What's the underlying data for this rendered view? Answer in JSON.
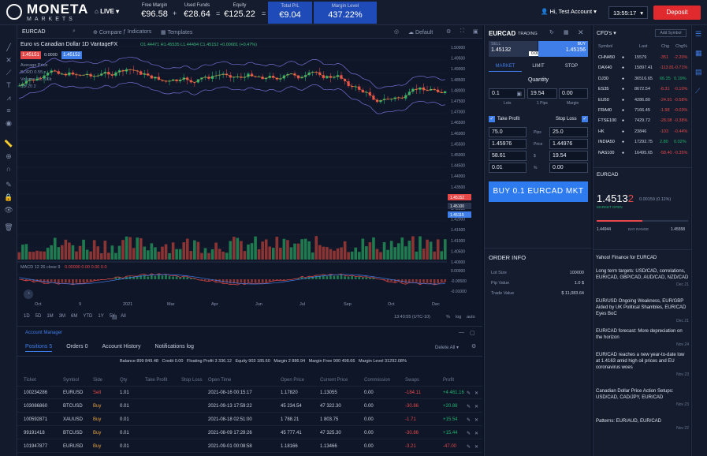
{
  "brand": {
    "name": "MONETA",
    "sub": "MARKETS"
  },
  "account": {
    "mode": "LIVE",
    "free_margin_label": "Free Margin",
    "free_margin": "€96.58",
    "used_funds_label": "Used Funds",
    "used_funds": "€28.64",
    "equity_label": "Equity",
    "equity": "€125.22",
    "total_pl_label": "Total P/L",
    "total_pl": "€9.04",
    "margin_level_label": "Margin Level",
    "margin_level": "437.22%",
    "ops": [
      "+",
      "=",
      "="
    ]
  },
  "user": {
    "greeting": "Hi, Test Account",
    "time": "13:55:17",
    "deposit": "Deposit"
  },
  "chart": {
    "symbol": "EURCAD",
    "compare": "Compare",
    "indicators": "Indicators",
    "templates": "Templates",
    "layout": "Default",
    "legend_title": "Euro vs Canadian Dollar 1D VantageFX",
    "ohlc": "O1.44471 H1.45535 L1.44494 C1.45152 +0.00681 (+0.47%)",
    "sell": "1.45151",
    "spread": "0.0000",
    "buy": "1.45152",
    "ind1": "Average Price",
    "ind2": "BORD 0.55 s",
    "ind3": "Volume 30,706k",
    "ind4": "BB 20 2",
    "macd": "MACD 12 26 close 9",
    "macd_vals": "0.00000 0.00 0.00 0.0",
    "price_labels": [
      "1.50000",
      "1.49500",
      "1.49000",
      "1.48500",
      "1.48000",
      "1.47500",
      "1.47000",
      "1.46500",
      "1.46000",
      "1.45500",
      "1.45000",
      "1.44500",
      "1.44000",
      "1.43500",
      "1.43000",
      "1.42500",
      "1.42000",
      "1.41500",
      "1.41000",
      "1.40500",
      "1.40000"
    ],
    "price_tags": [
      "1.45152",
      "1.45100",
      "1.45115"
    ],
    "time_labels": [
      "Oct",
      "9",
      "2021",
      "Mar",
      "Apr",
      "Jun",
      "Jul",
      "Sep",
      "Oct",
      "Dec"
    ],
    "macd_labels": [
      "0.00000",
      "-0.00500",
      "-0.01000"
    ],
    "timeframes": [
      "1D",
      "5D",
      "1M",
      "3M",
      "6M",
      "YTD",
      "1Y",
      "5Y",
      "All"
    ],
    "clock": "13:40:55 (UTC-10)",
    "pct": "%",
    "log": "log",
    "auto": "auto"
  },
  "trade": {
    "symbol": "EURCAD",
    "mode": "TRADING",
    "sell_price": "1.45132",
    "spread": "0.0000",
    "buy_label": "BUY",
    "buy_price": "1.45156",
    "sell_label": "SELL",
    "tabs": [
      "MARKET",
      "LIMIT",
      "STOP"
    ],
    "quantity_label": "Quantity",
    "qty": "0.1",
    "lots": "Lots",
    "units": "19.54",
    "unit_label": "1 Pips",
    "amount": "0.00",
    "amount_label": "Margin",
    "tp_label": "Take Profit",
    "sl_label": "Stop Loss",
    "tp_vals": [
      "75.0",
      "1.45976",
      "58.61",
      "0.01"
    ],
    "sl_vals": [
      "25.0",
      "1.44976",
      "19.54",
      "0.00"
    ],
    "mid_labels": [
      "Pips",
      "Price",
      "$",
      "%"
    ],
    "buy_button": "BUY 0.1 EURCAD MKT",
    "order_info": "ORDER INFO",
    "lot_size_label": "Lot Size",
    "lot_size": "100000",
    "pip_value_label": "Pip Value",
    "pip_value": "1.0 $",
    "trade_value_label": "Trade Value",
    "trade_value": "$ 11,083.64"
  },
  "watch": {
    "title": "CFD's",
    "add": "Add Symbol",
    "headers": [
      "Symbol",
      "Last",
      "Chg",
      "Chg%"
    ],
    "rows": [
      {
        "s": "CHN450",
        "l": "15579",
        "c": "-351",
        "p": "-2.20%",
        "d": "red"
      },
      {
        "s": "DAX40",
        "l": "15897.41",
        "c": "-113.81",
        "p": "-0.71%",
        "d": "red"
      },
      {
        "s": "DJ30",
        "l": "36516.65",
        "c": "66.35",
        "p": "0.19%",
        "d": "green"
      },
      {
        "s": "ES35",
        "l": "8672.54",
        "c": "-8.31",
        "p": "-0.10%",
        "d": "red"
      },
      {
        "s": "EU50",
        "l": "4286.80",
        "c": "-24.91",
        "p": "-0.58%",
        "d": "red"
      },
      {
        "s": "FRA40",
        "l": "7166.45",
        "c": "-1.98",
        "p": "-0.03%",
        "d": "red"
      },
      {
        "s": "FTSE100",
        "l": "7429.72",
        "c": "-28.08",
        "p": "-0.38%",
        "d": "red"
      },
      {
        "s": "HK",
        "l": "23846",
        "c": "-103",
        "p": "-0.44%",
        "d": "red"
      },
      {
        "s": "INDIA50",
        "l": "17292.75",
        "c": "2.80",
        "p": "0.02%",
        "d": "green"
      },
      {
        "s": "NAS100",
        "l": "16495.65",
        "c": "-58.40",
        "p": "-0.35%",
        "d": "red"
      }
    ],
    "detail_symbol": "EURCAD",
    "big_price": "1.4513",
    "big_sup": "2",
    "change": "0.00159 (0.11%)",
    "sub": "MARKET OPEN",
    "low": "1.44944",
    "high": "1.45558",
    "day_range": "DAY RANGE"
  },
  "news": {
    "title": "Yahoo! Finance for EURCAD",
    "items": [
      {
        "h": "Long term targets: USD/CAD, correlations, EUR/CAD, GBP/CAD, AUD/CAD, NZD/CAD",
        "t": "Dec 21"
      },
      {
        "h": "EUR/USD Ongoing Weakness, EUR/GBP Aided by UK Political Shambles, EUR/CAD Eyes BoC",
        "t": "Dec 21"
      },
      {
        "h": "EUR/CAD forecast: More depreciation on the horizon",
        "t": "Nov 24"
      },
      {
        "h": "EUR/CAD reaches a new year-to-date low at 1.4163 amid high oil prices and EU coronavirus woes",
        "t": "Nov 23"
      },
      {
        "h": "Canadian Dollar Price Action Setups: USD/CAD, CAD/JPY, EUR/CAD",
        "t": "Nov 23"
      },
      {
        "h": "Patterns: EUR/AUD, EUR/CAD",
        "t": "Nov 22"
      }
    ]
  },
  "positions": {
    "header_title": "Account Manager",
    "tabs": [
      "Positions 5",
      "Orders 0",
      "Account History",
      "Notifications log"
    ],
    "delete_all": "Delete All",
    "summary": "Balance 899 849.48   Credit 0.00   Floating Profit 3 336.12   Equity 903 185.60   Margin 2 886.94   Margin Free 900 498.66   Margin Level 31292.08%",
    "headers": [
      "Ticket",
      "Symbol",
      "Side",
      "Qty",
      "Take Profit",
      "Stop Loss",
      "Open Time",
      "Open Price",
      "Current Price",
      "Commission",
      "Swaps",
      "Profit"
    ],
    "rows": [
      {
        "ticket": "100234286",
        "symbol": "EURUSD",
        "side": "Sell",
        "qty": "1.01",
        "tp": "",
        "sl": "",
        "time": "2021-08-16 00:15:17",
        "open": "1.17820",
        "cur": "1.13055",
        "comm": "0.00",
        "swap": "-184.11",
        "profit": "+4 461.16"
      },
      {
        "ticket": "103086860",
        "symbol": "BTCUSD",
        "side": "Buy",
        "qty": "0.01",
        "tp": "",
        "sl": "",
        "time": "2021-09-13 17:59:22",
        "open": "45 234.54",
        "cur": "47 322.30",
        "comm": "0.00",
        "swap": "-30.86",
        "profit": "+20.88"
      },
      {
        "ticket": "100592871",
        "symbol": "XAUUSD",
        "side": "Buy",
        "qty": "0.01",
        "tp": "",
        "sl": "",
        "time": "2021-08-18 02:51:00",
        "open": "1 788.21",
        "cur": "1 803.75",
        "comm": "0.00",
        "swap": "-1.71",
        "profit": "+15.54"
      },
      {
        "ticket": "99191418",
        "symbol": "BTCUSD",
        "side": "Buy",
        "qty": "0.01",
        "tp": "",
        "sl": "",
        "time": "2021-08-09 17:29:26",
        "open": "45 777.41",
        "cur": "47 325.30",
        "comm": "0.00",
        "swap": "-30.86",
        "profit": "+15.44"
      },
      {
        "ticket": "101947877",
        "symbol": "EURUSD",
        "side": "Buy",
        "qty": "0.01",
        "tp": "",
        "sl": "",
        "time": "2021-09-01 00:08:58",
        "open": "1.18166",
        "cur": "1.13466",
        "comm": "0.00",
        "swap": "-3.21",
        "profit": "-47.00"
      }
    ]
  }
}
